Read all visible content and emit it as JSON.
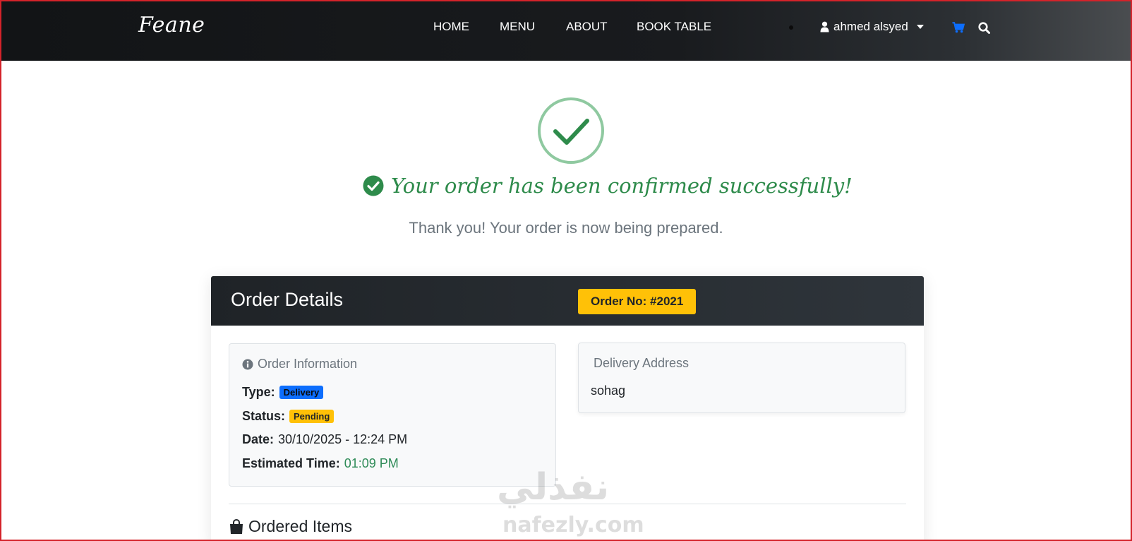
{
  "header": {
    "logo": "Feane",
    "nav": [
      {
        "label": "HOME"
      },
      {
        "label": "MENU"
      },
      {
        "label": "ABOUT"
      },
      {
        "label": "BOOK TABLE"
      }
    ],
    "user": {
      "name": "ahmed alsyed",
      "icon": "user-icon"
    },
    "cart_icon": "shopping-cart-icon",
    "search_icon": "search-icon",
    "cart_color": "#0d6efd"
  },
  "confirmation": {
    "icon": "check-circle-icon",
    "message": "Your order has been confirmed successfully!",
    "submessage": "Thank you! Your order is now being prepared.",
    "accent": "#2e8b4b"
  },
  "order": {
    "title": "Order Details",
    "order_no": "Order No: #2021",
    "info": {
      "heading": "Order Information",
      "type_label": "Type:",
      "type_value": "Delivery",
      "status_label": "Status:",
      "status_value": "Pending",
      "date_label": "Date:",
      "date_value": "30/10/2025 - 12:24 PM",
      "estimated_label": "Estimated Time:",
      "estimated_value": "01:09 PM"
    },
    "address": {
      "heading": "Delivery Address",
      "value": "sohag"
    },
    "items_title": "Ordered Items"
  },
  "watermark": {
    "arabic": "نفذلي",
    "latin": "nafezly.com"
  }
}
